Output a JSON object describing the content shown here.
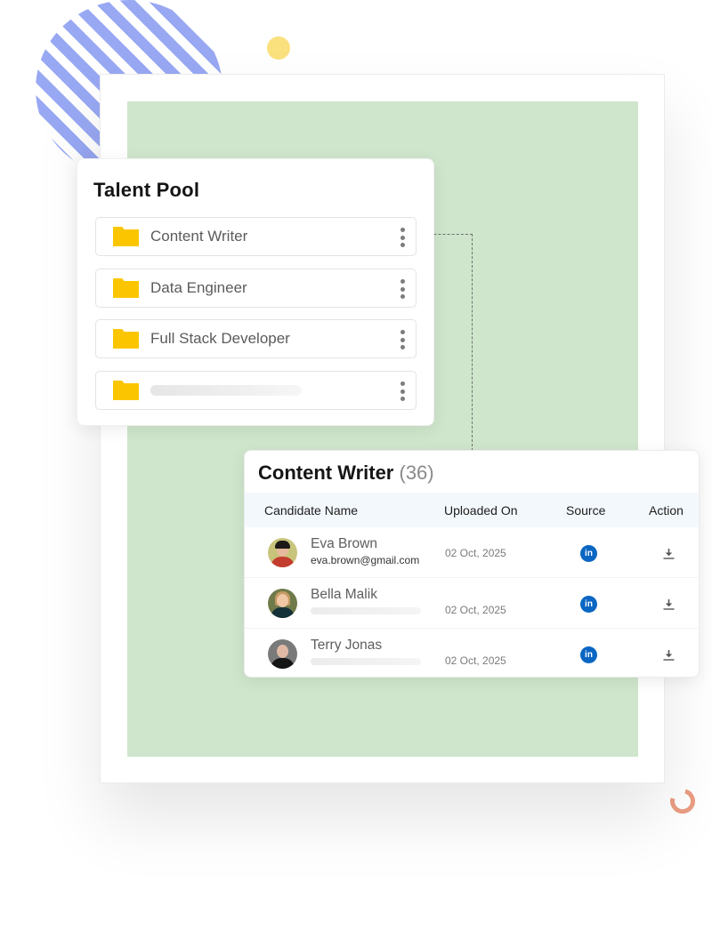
{
  "colors": {
    "stripe": "#98a8f3",
    "dot_yellow": "#fbe17d",
    "ring_salmon": "#eb9d82",
    "frame_green": "#cfe6cc",
    "folder_yellow": "#fbc600",
    "linkedin_blue": "#0a66c2",
    "table_header_bg": "#f3f8fd"
  },
  "talent_pool": {
    "title": "Talent Pool",
    "folders": [
      {
        "label": "Content Writer",
        "icon": "folder-icon",
        "menu_icon": "kebab-menu-icon"
      },
      {
        "label": "Data Engineer",
        "icon": "folder-icon",
        "menu_icon": "kebab-menu-icon"
      },
      {
        "label": "Full Stack Developer",
        "icon": "folder-icon",
        "menu_icon": "kebab-menu-icon"
      },
      {
        "label": "",
        "icon": "folder-icon",
        "menu_icon": "kebab-menu-icon",
        "placeholder": true
      }
    ]
  },
  "content_writer": {
    "title": "Content Writer",
    "count": "(36)",
    "columns": [
      "Candidate Name",
      "Uploaded On",
      "Source",
      "Action"
    ],
    "rows": [
      {
        "name": "Eva Brown",
        "email": "eva.brown@gmail.com",
        "uploaded_on": "02 Oct, 2025",
        "source": "linkedin",
        "source_glyph": "in",
        "action": "download-icon"
      },
      {
        "name": "Bella Malik",
        "email": "",
        "uploaded_on": "02 Oct, 2025",
        "source": "linkedin",
        "source_glyph": "in",
        "action": "download-icon"
      },
      {
        "name": "Terry Jonas",
        "email": "",
        "uploaded_on": "02 Oct, 2025",
        "source": "linkedin",
        "source_glyph": "in",
        "action": "download-icon"
      }
    ]
  }
}
